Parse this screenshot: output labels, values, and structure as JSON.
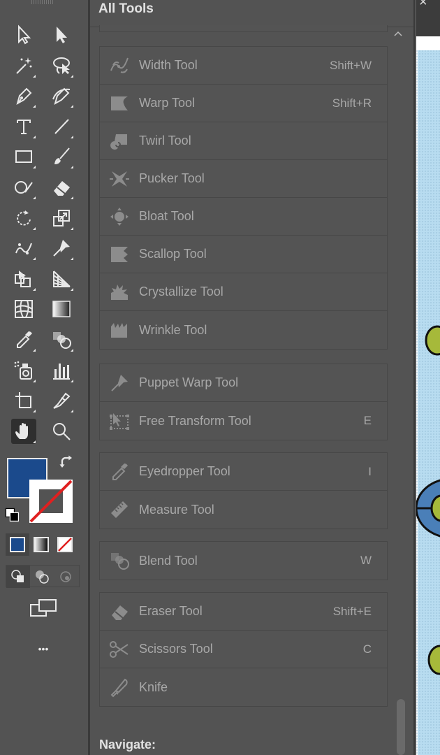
{
  "panel": {
    "title": "All Tools",
    "groups": [
      {
        "items": [
          {
            "icon": "width-tool-icon",
            "label": "Width Tool",
            "shortcut": "Shift+W"
          },
          {
            "icon": "warp-tool-icon",
            "label": "Warp Tool",
            "shortcut": "Shift+R"
          },
          {
            "icon": "twirl-tool-icon",
            "label": "Twirl Tool",
            "shortcut": ""
          },
          {
            "icon": "pucker-tool-icon",
            "label": "Pucker Tool",
            "shortcut": ""
          },
          {
            "icon": "bloat-tool-icon",
            "label": "Bloat Tool",
            "shortcut": ""
          },
          {
            "icon": "scallop-tool-icon",
            "label": "Scallop Tool",
            "shortcut": ""
          },
          {
            "icon": "crystallize-tool-icon",
            "label": "Crystallize Tool",
            "shortcut": ""
          },
          {
            "icon": "wrinkle-tool-icon",
            "label": "Wrinkle Tool",
            "shortcut": ""
          }
        ]
      },
      {
        "items": [
          {
            "icon": "puppet-warp-icon",
            "label": "Puppet Warp Tool",
            "shortcut": ""
          },
          {
            "icon": "free-transform-icon",
            "label": "Free Transform Tool",
            "shortcut": "E"
          }
        ]
      },
      {
        "items": [
          {
            "icon": "eyedropper-icon",
            "label": "Eyedropper Tool",
            "shortcut": "I"
          },
          {
            "icon": "measure-icon",
            "label": "Measure Tool",
            "shortcut": ""
          }
        ]
      },
      {
        "items": [
          {
            "icon": "blend-icon",
            "label": "Blend Tool",
            "shortcut": "W"
          }
        ]
      },
      {
        "items": [
          {
            "icon": "eraser-icon",
            "label": "Eraser Tool",
            "shortcut": "Shift+E"
          },
          {
            "icon": "scissors-icon",
            "label": "Scissors Tool",
            "shortcut": "C"
          },
          {
            "icon": "knife-icon",
            "label": "Knife",
            "shortcut": ""
          }
        ]
      }
    ],
    "next_section": "Navigate:"
  },
  "toolbar": {
    "more_label": "•••",
    "fill_color": "#1b4a8c",
    "tools": [
      "selection-icon",
      "direct-selection-icon",
      "magic-wand-icon",
      "lasso-icon",
      "pen-icon",
      "curvature-icon",
      "type-icon",
      "line-segment-icon",
      "rectangle-icon",
      "paintbrush-icon",
      "shaper-icon",
      "eraser-icon",
      "rotate-icon",
      "scale-icon",
      "width-icon",
      "puppet-warp-icon",
      "shape-builder-icon",
      "perspective-grid-icon",
      "mesh-icon",
      "gradient-icon",
      "eyedropper-icon",
      "blend-icon",
      "symbol-sprayer-icon",
      "column-graph-icon",
      "artboard-icon",
      "slice-icon",
      "hand-icon",
      "zoom-icon"
    ]
  },
  "window": {
    "close_glyph": "×"
  }
}
